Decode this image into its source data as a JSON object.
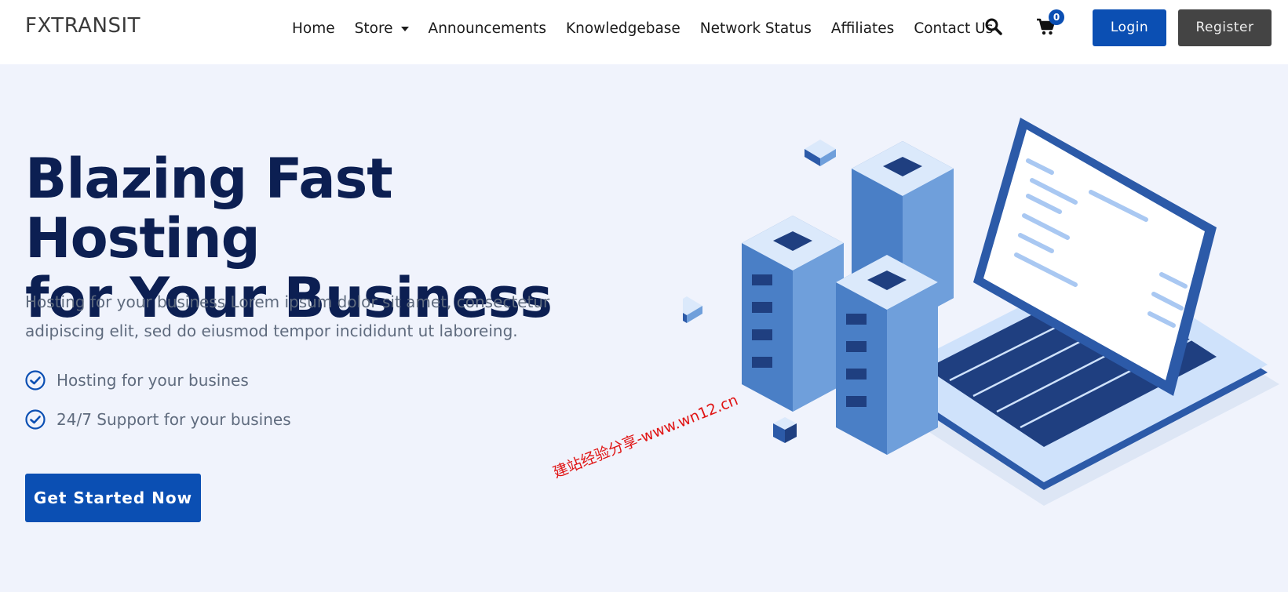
{
  "header": {
    "logo": "FXTRANSIT",
    "nav": [
      {
        "label": "Home"
      },
      {
        "label": "Store",
        "has_dropdown": true
      },
      {
        "label": "Announcements"
      },
      {
        "label": "Knowledgebase"
      },
      {
        "label": "Network Status"
      },
      {
        "label": "Affiliates"
      },
      {
        "label": "Contact Us"
      }
    ],
    "search_icon": "search-icon",
    "cart_icon": "cart-icon",
    "cart_count": "0",
    "login_label": "Login",
    "register_label": "Register"
  },
  "hero": {
    "title_line1": "Blazing Fast Hosting",
    "title_line2": "for Your Business",
    "description": "Hosting for your business Lorem ipsum dolor sit amet, consectetur adipiscing elit, sed do eiusmod tempor incididunt ut laboreing.",
    "features": [
      {
        "label": "Hosting for your busines"
      },
      {
        "label": "24/7 Support for your busines"
      }
    ],
    "cta_label": "Get Started Now"
  },
  "watermark": "建站经验分享-www.wn12.cn",
  "colors": {
    "primary": "#0b4fb3",
    "navy": "#0c1f52",
    "background": "#f0f3fc",
    "register": "#444444",
    "watermark": "#e01414"
  }
}
